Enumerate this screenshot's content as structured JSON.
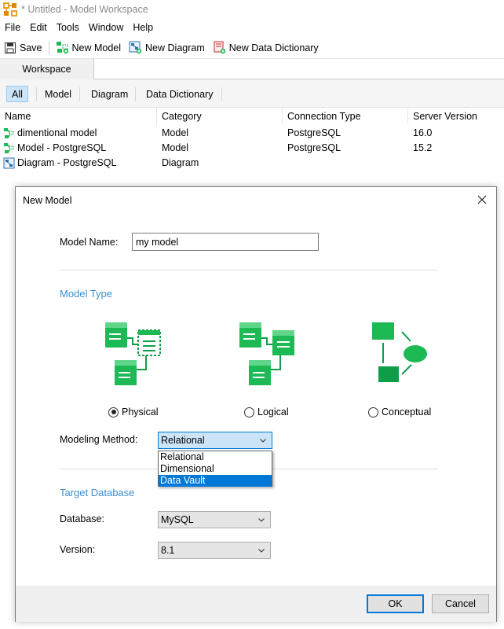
{
  "window": {
    "title": "* Untitled - Model Workspace"
  },
  "menu": [
    "File",
    "Edit",
    "Tools",
    "Window",
    "Help"
  ],
  "toolbar": {
    "save": "Save",
    "new_model": "New Model",
    "new_diagram": "New Diagram",
    "new_data_dictionary": "New Data Dictionary"
  },
  "workspace": {
    "tab": "Workspace",
    "filters": [
      "All",
      "Model",
      "Diagram",
      "Data Dictionary"
    ],
    "active_filter": "All",
    "columns": [
      "Name",
      "Category",
      "Connection Type",
      "Server Version"
    ],
    "rows": [
      {
        "name": "dimentional model",
        "category": "Model",
        "connection": "PostgreSQL",
        "version": "16.0",
        "icon": "model-icon"
      },
      {
        "name": "Model - PostgreSQL",
        "category": "Model",
        "connection": "PostgreSQL",
        "version": "15.2",
        "icon": "model-icon"
      },
      {
        "name": "Diagram - PostgreSQL",
        "category": "Diagram",
        "connection": "",
        "version": "",
        "icon": "diagram-icon"
      }
    ]
  },
  "dialog": {
    "title": "New Model",
    "model_name_label": "Model Name:",
    "model_name_value": "my model",
    "model_type_heading": "Model Type",
    "model_types": [
      {
        "label": "Physical",
        "selected": true
      },
      {
        "label": "Logical",
        "selected": false
      },
      {
        "label": "Conceptual",
        "selected": false
      }
    ],
    "modeling_method_label": "Modeling Method:",
    "modeling_method_value": "Relational",
    "modeling_method_options": [
      "Relational",
      "Dimensional",
      "Data Vault"
    ],
    "highlighted_option": "Data Vault",
    "target_db_heading": "Target Database",
    "database_label": "Database:",
    "database_value": "MySQL",
    "version_label": "Version:",
    "version_value": "8.1",
    "ok": "OK",
    "cancel": "Cancel"
  },
  "colors": {
    "accent": "#0078d7",
    "section_heading": "#3c8fd2",
    "icon_green": "#1db954",
    "icon_green_dark": "#0f9d4a",
    "icon_green_light": "#5fd68a"
  }
}
